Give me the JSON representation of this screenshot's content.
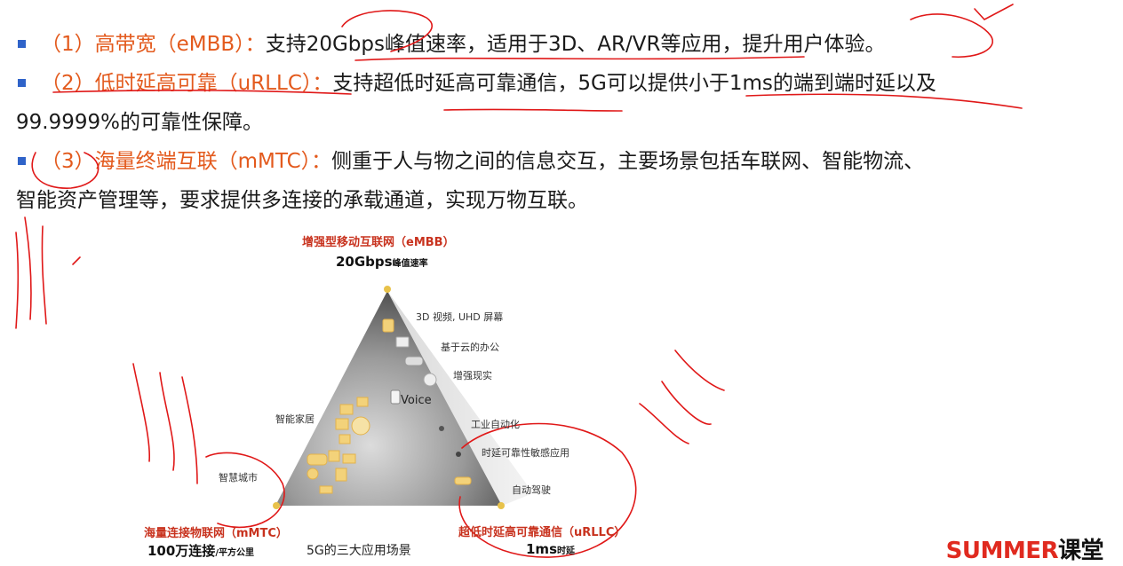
{
  "bullets": [
    {
      "highlight": "（1）高带宽（eMBB）：",
      "text": "支持20Gbps峰值速率，适用于3D、AR/VR等应用，提升用户体验。",
      "cont": ""
    },
    {
      "highlight": "（2）低时延高可靠（uRLLC）：",
      "text": "支持超低时延高可靠通信，5G可以提供小于1ms的端到端时延以及",
      "cont": "99.9999%的可靠性保障。"
    },
    {
      "highlight": "（3）海量终端互联（mMTC）：",
      "text": "侧重于人与物之间的信息交互，主要场景包括车联网、智能物流、",
      "cont": "智能资产管理等，要求提供多连接的承载通道，实现万物互联。"
    }
  ],
  "figure": {
    "top_title": "增强型移动互联网（eMBB）",
    "top_value": "20Gbps",
    "top_unit": "峰值速率",
    "left_title": "海量连接物联网（mMTC）",
    "left_value": "100万连接",
    "left_unit": "/平方公里",
    "right_title": "超低时延高可靠通信（uRLLC）",
    "right_value": "1ms",
    "right_unit": "时延",
    "caption": "5G的三大应用场景",
    "voice": "Voice",
    "labels": {
      "uhd": "3D 视频, UHD 屏幕",
      "cloud": "基于云的办公",
      "ar": "增强现实",
      "home": "智能家居",
      "industry": "工业自动化",
      "sensitive": "时延可靠性敏感应用",
      "city": "智慧城市",
      "driving": "自动驾驶"
    }
  },
  "logo": {
    "red": "SUMMER",
    "black": "课堂"
  },
  "colors": {
    "highlight": "#e35a1d",
    "bullet": "#2f63c9",
    "annotation": "#e01818",
    "figure_red": "#c8321e"
  }
}
